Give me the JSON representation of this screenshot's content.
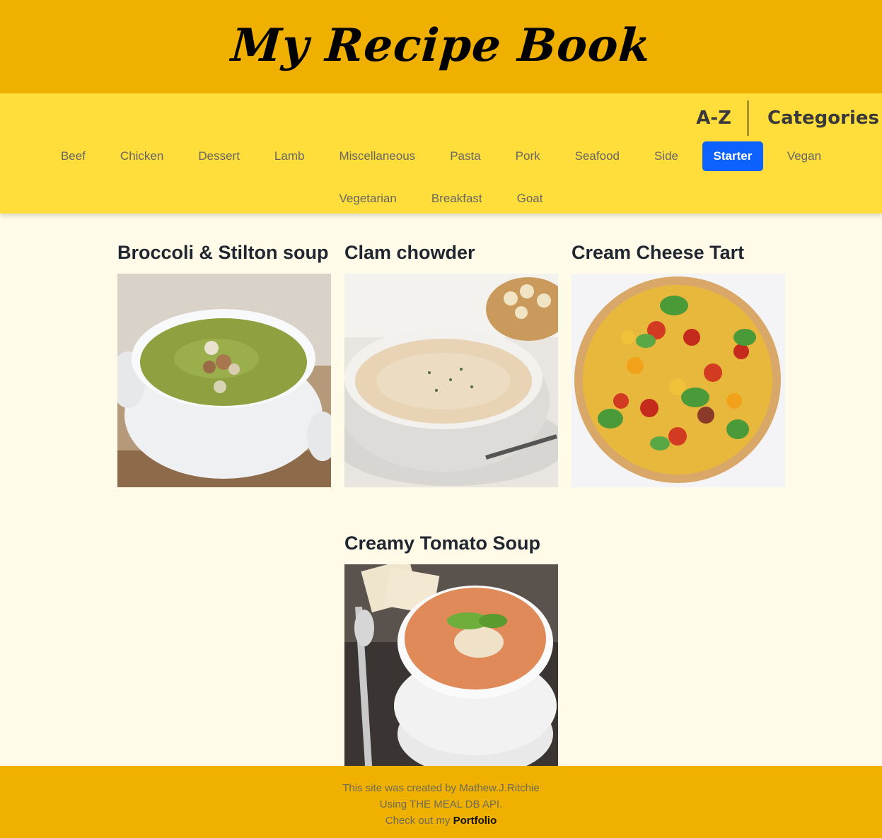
{
  "header": {
    "title": "My Recipe Book"
  },
  "nav": {
    "modes": [
      {
        "label": "A-Z"
      },
      {
        "label": "Categories"
      }
    ],
    "categories_row1": [
      {
        "label": "Beef",
        "active": false
      },
      {
        "label": "Chicken",
        "active": false
      },
      {
        "label": "Dessert",
        "active": false
      },
      {
        "label": "Lamb",
        "active": false
      },
      {
        "label": "Miscellaneous",
        "active": false
      },
      {
        "label": "Pasta",
        "active": false
      },
      {
        "label": "Pork",
        "active": false
      },
      {
        "label": "Seafood",
        "active": false
      },
      {
        "label": "Side",
        "active": false
      },
      {
        "label": "Starter",
        "active": true
      },
      {
        "label": "Vegan",
        "active": false
      }
    ],
    "categories_row2": [
      {
        "label": "Vegetarian",
        "active": false
      },
      {
        "label": "Breakfast",
        "active": false
      },
      {
        "label": "Goat",
        "active": false
      }
    ],
    "active_color": "#0d62ff"
  },
  "recipes": [
    {
      "title": "Broccoli & Stilton soup",
      "image": "green-soup-bowl-photo"
    },
    {
      "title": "Clam chowder",
      "image": "cream-chowder-bowl-photo"
    },
    {
      "title": "Cream Cheese Tart",
      "image": "tomato-tart-photo"
    },
    {
      "title": "Creamy Tomato Soup",
      "image": "tomato-soup-bowl-photo"
    }
  ],
  "footer": {
    "line1": "This site was created by Mathew.J.Ritchie",
    "line2": "Using THE MEAL DB API.",
    "line3_prefix": "Check out my",
    "portfolio_link": "Portfolio"
  },
  "colors": {
    "header_bg": "#f0b000",
    "nav_bg": "#ffdd3a",
    "page_bg": "#fffbe8"
  }
}
